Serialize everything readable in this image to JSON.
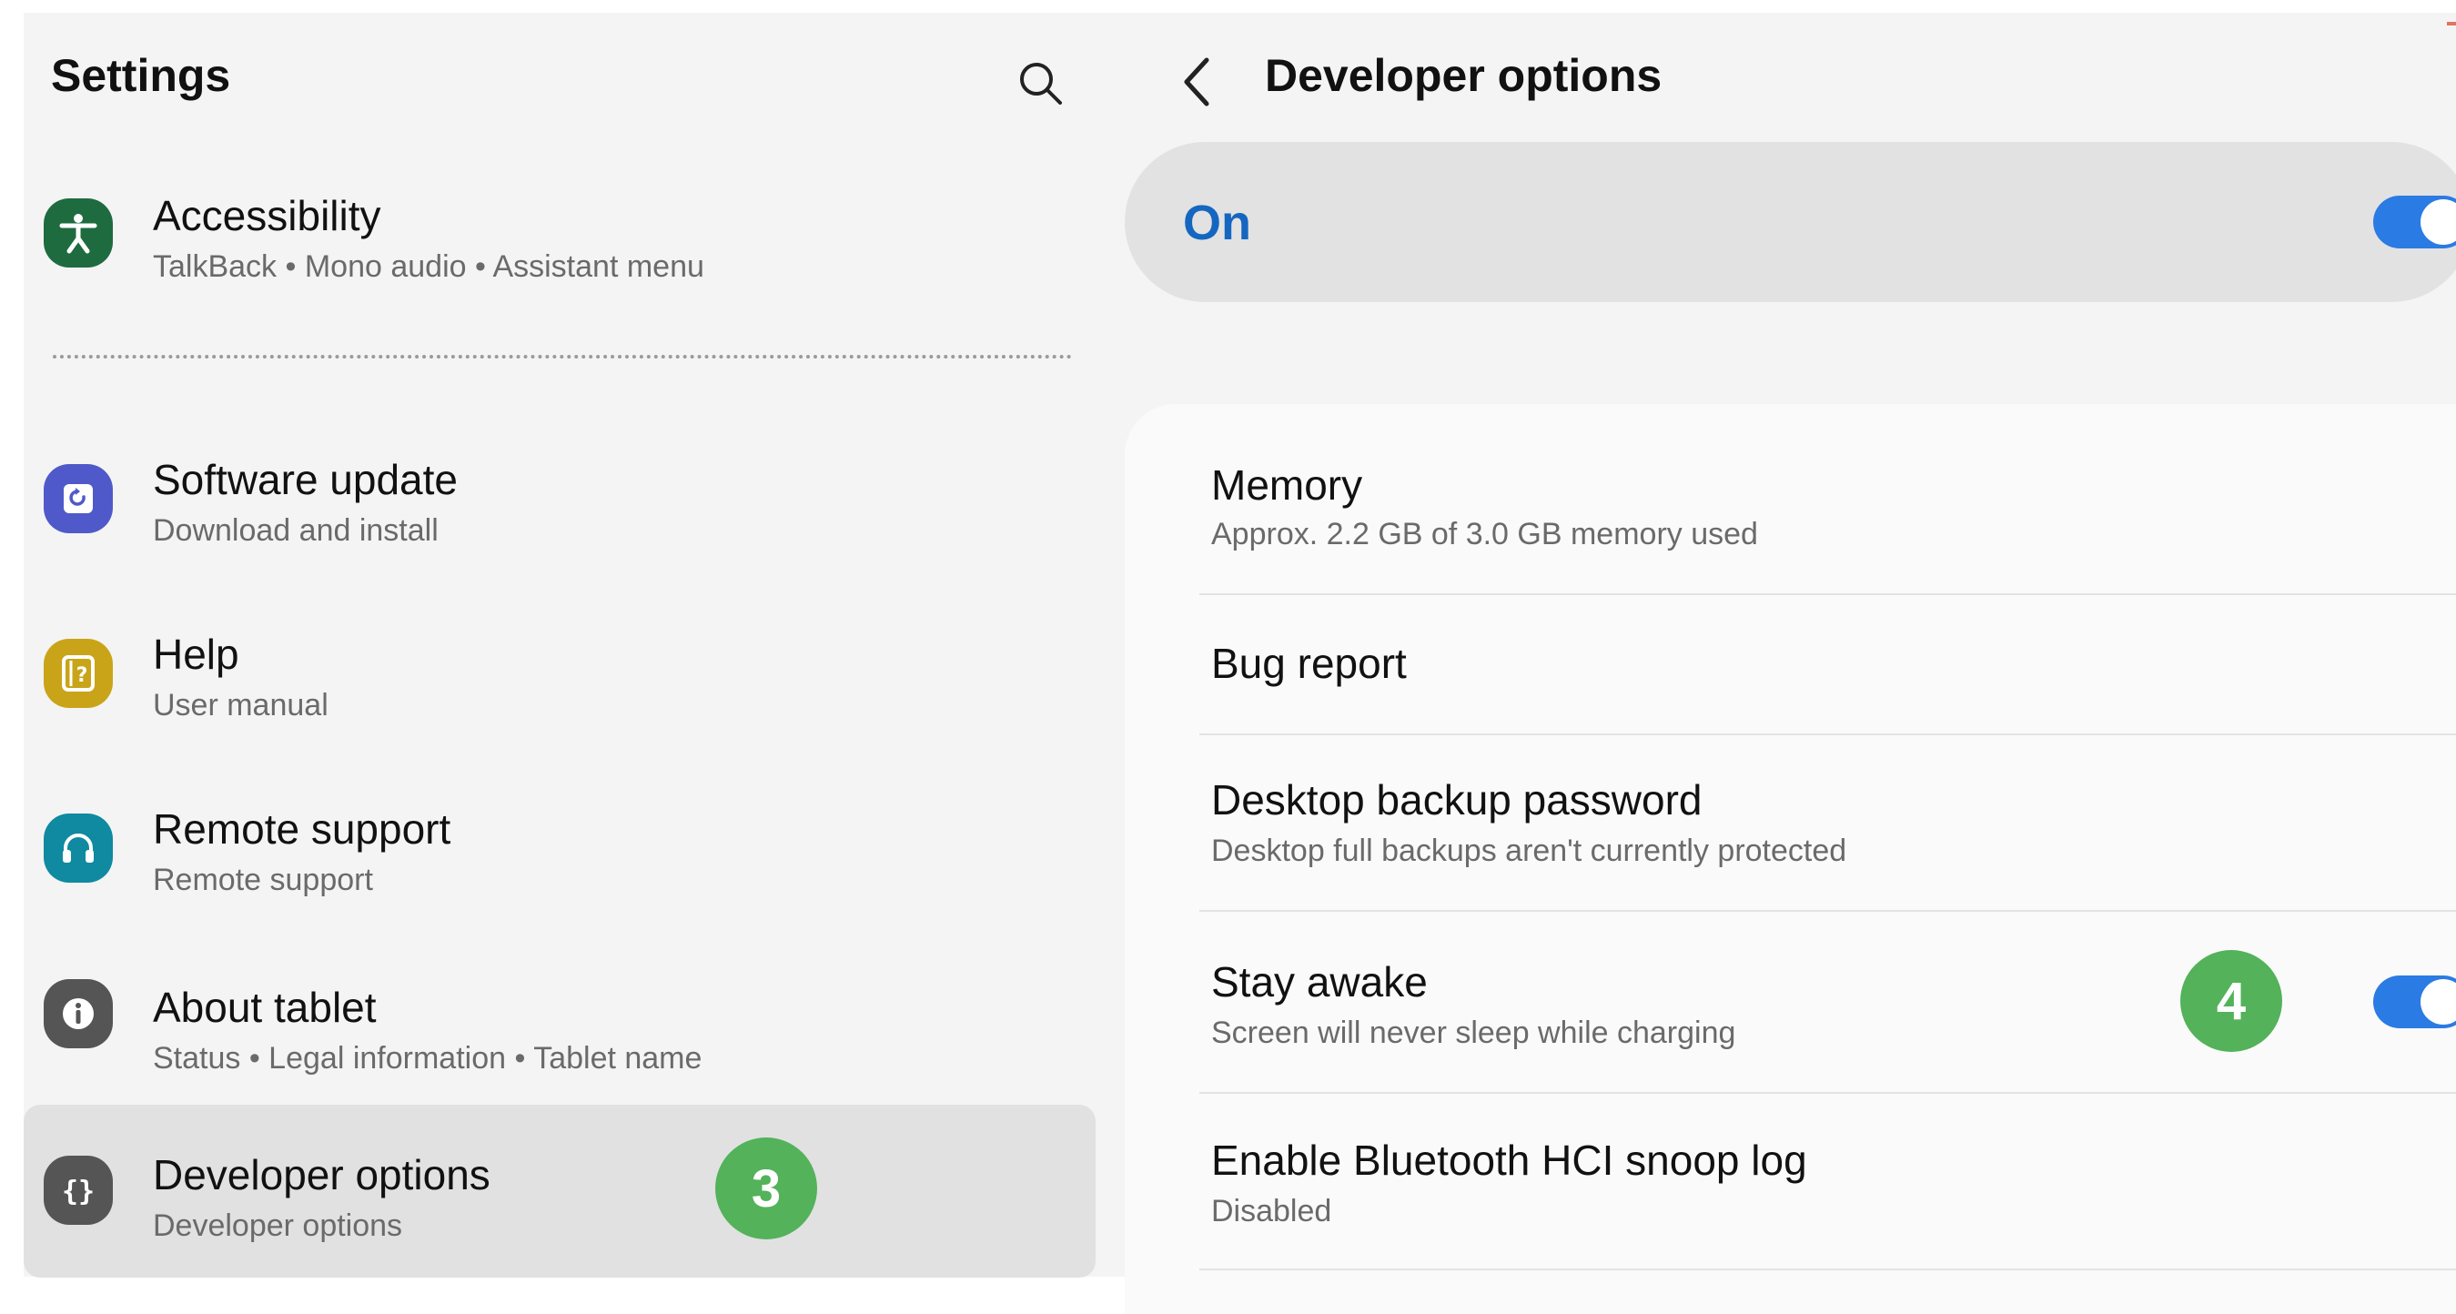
{
  "settings": {
    "title": "Settings",
    "search_icon": "search-icon",
    "items": [
      {
        "title": "Accessibility",
        "subtitle": "TalkBack  •  Mono audio  •  Assistant menu",
        "icon": "accessibility-icon",
        "icon_color": "#1e6b3f"
      },
      {
        "title": "Software update",
        "subtitle": "Download and install",
        "icon": "software-update-icon",
        "icon_color": "#5059c9"
      },
      {
        "title": "Help",
        "subtitle": "User manual",
        "icon": "help-icon",
        "icon_color": "#c9a418"
      },
      {
        "title": "Remote support",
        "subtitle": "Remote support",
        "icon": "headset-icon",
        "icon_color": "#0f8aa0"
      },
      {
        "title": "About tablet",
        "subtitle": "Status  •  Legal information  •  Tablet name",
        "icon": "info-icon",
        "icon_color": "#555555"
      },
      {
        "title": "Developer options",
        "subtitle": "Developer options",
        "icon": "developer-braces-icon",
        "icon_color": "#555555",
        "selected": true
      }
    ]
  },
  "developer": {
    "back_icon": "back-chevron-icon",
    "title": "Developer options",
    "master_switch": {
      "label": "On",
      "checked": true
    },
    "rows": [
      {
        "title": "Memory",
        "subtitle": "Approx. 2.2 GB of 3.0 GB memory used"
      },
      {
        "title": "Bug report",
        "subtitle": ""
      },
      {
        "title": "Desktop backup password",
        "subtitle": "Desktop full backups aren't currently protected"
      },
      {
        "title": "Stay awake",
        "subtitle": "Screen will never sleep while charging",
        "toggle": true,
        "checked": true
      },
      {
        "title": "Enable Bluetooth HCI snoop log",
        "subtitle": "Disabled"
      }
    ]
  },
  "badges": {
    "step3": "3",
    "step4": "4"
  },
  "colors": {
    "accent": "#2a7be4",
    "on_text": "#1566c0",
    "badge": "#53b25a"
  }
}
